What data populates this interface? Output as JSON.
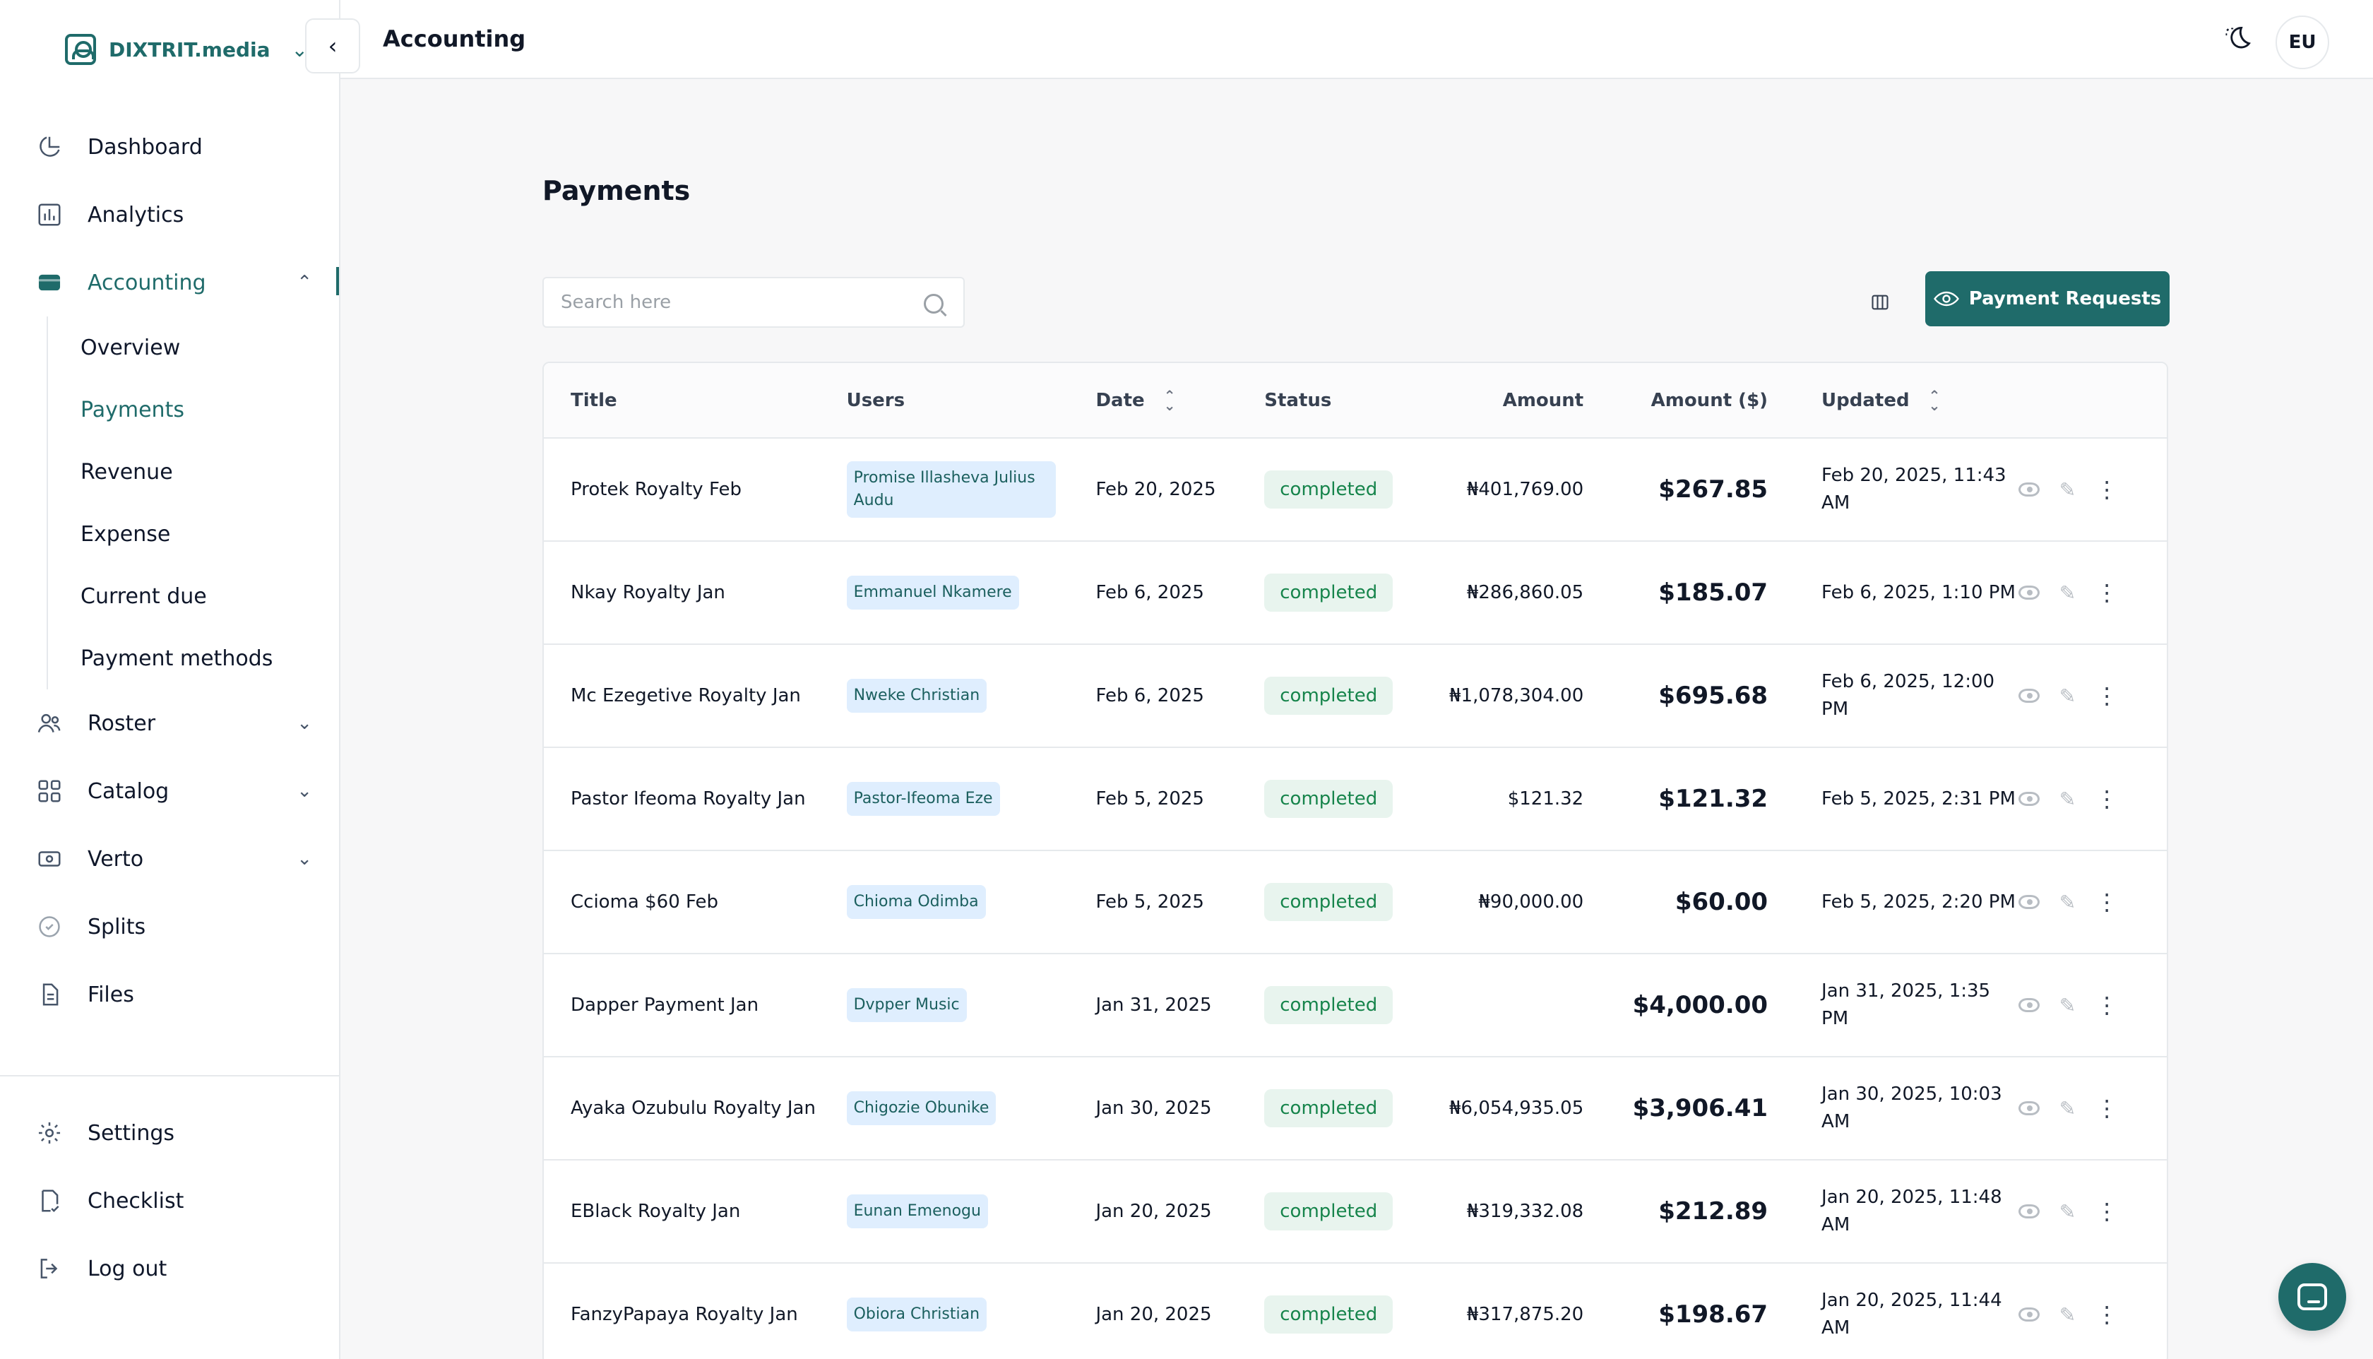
{
  "brand": {
    "name": "DIXTRIT.media"
  },
  "topbar": {
    "title": "Accounting",
    "avatar_initials": "EU"
  },
  "sidebar": {
    "items": [
      {
        "label": "Dashboard",
        "icon": "pie-chart-icon"
      },
      {
        "label": "Analytics",
        "icon": "bar-chart-icon"
      },
      {
        "label": "Accounting",
        "icon": "card-icon"
      },
      {
        "label": "Roster",
        "icon": "users-icon"
      },
      {
        "label": "Catalog",
        "icon": "grid-icon"
      },
      {
        "label": "Verto",
        "icon": "cash-icon"
      },
      {
        "label": "Splits",
        "icon": "splits-icon"
      },
      {
        "label": "Files",
        "icon": "file-icon"
      }
    ],
    "accounting_sub": [
      "Overview",
      "Payments",
      "Revenue",
      "Expense",
      "Current due",
      "Payment methods"
    ],
    "bottom": [
      {
        "label": "Settings",
        "icon": "gear-icon"
      },
      {
        "label": "Checklist",
        "icon": "checklist-icon"
      },
      {
        "label": "Log out",
        "icon": "logout-icon"
      }
    ]
  },
  "main": {
    "title": "Payments",
    "search_placeholder": "Search here",
    "payment_requests_label": "Payment Requests",
    "columns": [
      "Title",
      "Users",
      "Date",
      "Status",
      "Amount",
      "Amount ($)",
      "Updated"
    ],
    "rows": [
      {
        "title": "Protek Royalty Feb",
        "user": "Promise Illasheva Julius Audu",
        "date": "Feb 20, 2025",
        "status": "completed",
        "amount": "₦401,769.00",
        "usd": "$267.85",
        "updated": "Feb 20, 2025, 11:43 AM"
      },
      {
        "title": "Nkay Royalty Jan",
        "user": "Emmanuel Nkamere",
        "date": "Feb 6, 2025",
        "status": "completed",
        "amount": "₦286,860.05",
        "usd": "$185.07",
        "updated": "Feb 6, 2025, 1:10 PM"
      },
      {
        "title": "Mc Ezegetive Royalty Jan",
        "user": "Nweke Christian",
        "date": "Feb 6, 2025",
        "status": "completed",
        "amount": "₦1,078,304.00",
        "usd": "$695.68",
        "updated": "Feb 6, 2025, 12:00 PM"
      },
      {
        "title": "Pastor Ifeoma Royalty Jan",
        "user": "Pastor-Ifeoma Eze",
        "date": "Feb 5, 2025",
        "status": "completed",
        "amount": "$121.32",
        "usd": "$121.32",
        "updated": "Feb 5, 2025, 2:31 PM"
      },
      {
        "title": "Ccioma $60 Feb",
        "user": "Chioma Odimba",
        "date": "Feb 5, 2025",
        "status": "completed",
        "amount": "₦90,000.00",
        "usd": "$60.00",
        "updated": "Feb 5, 2025, 2:20 PM"
      },
      {
        "title": "Dapper Payment Jan",
        "user": "Dvpper Music",
        "date": "Jan 31, 2025",
        "status": "completed",
        "amount": "",
        "usd": "$4,000.00",
        "updated": "Jan 31, 2025, 1:35 PM"
      },
      {
        "title": "Ayaka Ozubulu Royalty Jan",
        "user": "Chigozie Obunike",
        "date": "Jan 30, 2025",
        "status": "completed",
        "amount": "₦6,054,935.05",
        "usd": "$3,906.41",
        "updated": "Jan 30, 2025, 10:03 AM"
      },
      {
        "title": "EBlack Royalty Jan",
        "user": "Eunan Emenogu",
        "date": "Jan 20, 2025",
        "status": "completed",
        "amount": "₦319,332.08",
        "usd": "$212.89",
        "updated": "Jan 20, 2025, 11:48 AM"
      },
      {
        "title": "FanzyPapaya Royalty Jan",
        "user": "Obiora Christian",
        "date": "Jan 20, 2025",
        "status": "completed",
        "amount": "₦317,875.20",
        "usd": "$198.67",
        "updated": "Jan 20, 2025, 11:44 AM"
      }
    ]
  },
  "colors": {
    "accent": "#1f6b6a",
    "status_bg": "#e8f4ee",
    "status_text": "#16844b",
    "user_chip_bg": "#dfeefe"
  }
}
